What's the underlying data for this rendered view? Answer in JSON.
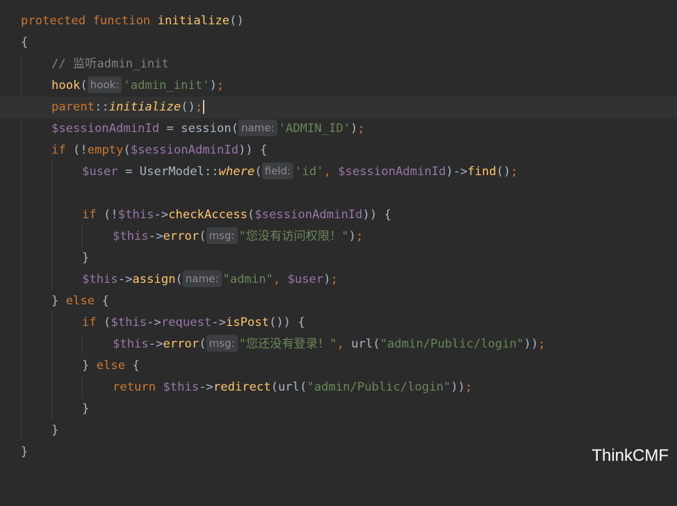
{
  "theme": {
    "background": "#2b2b2b",
    "current_line": "#323232",
    "keyword": "#cc7832",
    "function": "#ffc66d",
    "string": "#6a8759",
    "variable": "#9876aa",
    "comment": "#808080",
    "plain": "#a9b7c6"
  },
  "code": {
    "l1": {
      "kw1": "protected",
      "kw2": "function",
      "name": "initialize",
      "paren": "()"
    },
    "l2": {
      "brace": "{"
    },
    "l3": {
      "comment": "// 监听admin_init"
    },
    "l4": {
      "fn": "hook",
      "open": "(",
      "hint": "hook:",
      "arg": "'admin_init'",
      "close": ")",
      "semi": ";"
    },
    "l5": {
      "kw": "parent",
      "sep": "::",
      "fn": "initialize",
      "paren": "()",
      "semi": ";"
    },
    "l6": {
      "var": "$sessionAdminId",
      "eq": " = ",
      "fn": "session",
      "open": "(",
      "hint": "name:",
      "arg": "'ADMIN_ID'",
      "close": ")",
      "semi": ";"
    },
    "l7": {
      "kw": "if",
      "p1": " (!",
      "fn": "empty",
      "open": "(",
      "var": "$sessionAdminId",
      "close": ")) {"
    },
    "l8": {
      "var": "$user",
      "eq": " = ",
      "cls": "UserModel",
      "sep": "::",
      "fn": "where",
      "open": "(",
      "hint": "field:",
      "arg": "'id'",
      "comma": ", ",
      "var2": "$sessionAdminId",
      "close": ")->",
      "fn2": "find",
      "paren": "()",
      "semi": ";"
    },
    "l10": {
      "kw": "if",
      "p1": " (!",
      "var": "$this",
      "arrow": "->",
      "fn": "checkAccess",
      "open": "(",
      "var2": "$sessionAdminId",
      "close": ")) {"
    },
    "l11": {
      "var": "$this",
      "arrow": "->",
      "fn": "error",
      "open": "(",
      "hint": "msg:",
      "arg": "\"您没有访问权限！\"",
      "close": ")",
      "semi": ";"
    },
    "l12": {
      "brace": "}"
    },
    "l13": {
      "var": "$this",
      "arrow": "->",
      "fn": "assign",
      "open": "(",
      "hint": "name:",
      "arg": "\"admin\"",
      "comma": ", ",
      "var2": "$user",
      "close": ")",
      "semi": ";"
    },
    "l14": {
      "brace": "} ",
      "kw": "else",
      "brace2": " {"
    },
    "l15": {
      "kw": "if",
      "p1": " (",
      "var": "$this",
      "arrow": "->",
      "prop": "request",
      "arrow2": "->",
      "fn": "isPost",
      "close": "()) {"
    },
    "l16": {
      "var": "$this",
      "arrow": "->",
      "fn": "error",
      "open": "(",
      "hint": "msg:",
      "arg": "\"您还没有登录！\"",
      "comma": ", ",
      "fn2": "url",
      "open2": "(",
      "arg2": "\"admin/Public/login\"",
      "close": "))",
      "semi": ";"
    },
    "l17": {
      "brace": "} ",
      "kw": "else",
      "brace2": " {"
    },
    "l18": {
      "kw": "return",
      "sp": " ",
      "var": "$this",
      "arrow": "->",
      "fn": "redirect",
      "open": "(",
      "fn2": "url",
      "open2": "(",
      "arg": "\"admin/Public/login\"",
      "close": "))",
      "semi": ";"
    },
    "l19": {
      "brace": "}"
    },
    "l20": {
      "brace": "}"
    },
    "l21": {
      "brace": "}"
    }
  },
  "watermark": "ThinkCMF"
}
